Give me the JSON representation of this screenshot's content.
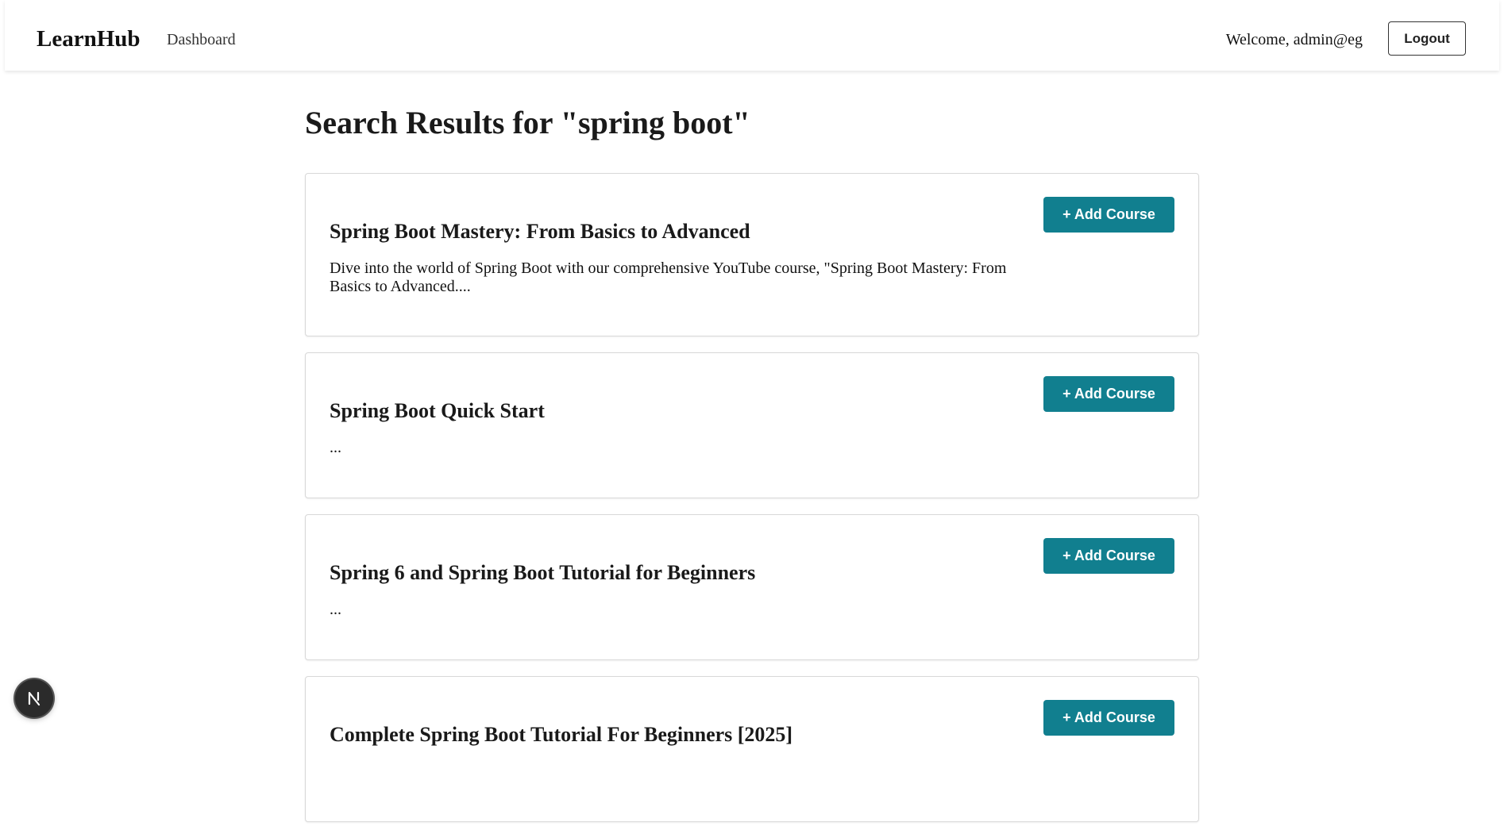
{
  "navbar": {
    "brand": "LearnHub",
    "links": [
      "Dashboard"
    ],
    "welcome": "Welcome, admin@eg",
    "logout_label": "Logout"
  },
  "page": {
    "title": "Search Results for \"spring boot\""
  },
  "results": [
    {
      "title": "Spring Boot Mastery: From Basics to Advanced",
      "description": "Dive into the world of Spring Boot with our comprehensive YouTube course, \"Spring Boot Mastery: From Basics to Advanced....",
      "button_label": "+ Add Course"
    },
    {
      "title": "Spring Boot Quick Start",
      "description": "...",
      "button_label": "+ Add Course"
    },
    {
      "title": "Spring 6 and Spring Boot Tutorial for Beginners",
      "description": "...",
      "button_label": "+ Add Course"
    },
    {
      "title": "Complete Spring Boot Tutorial For Beginners [2025]",
      "description": "",
      "button_label": "+ Add Course"
    }
  ],
  "dev_badge": {
    "icon": "nextjs-n-icon",
    "letter": "N"
  },
  "colors": {
    "accent": "#117f8f",
    "background": "#ffffff",
    "text": "#1a1a1a"
  }
}
